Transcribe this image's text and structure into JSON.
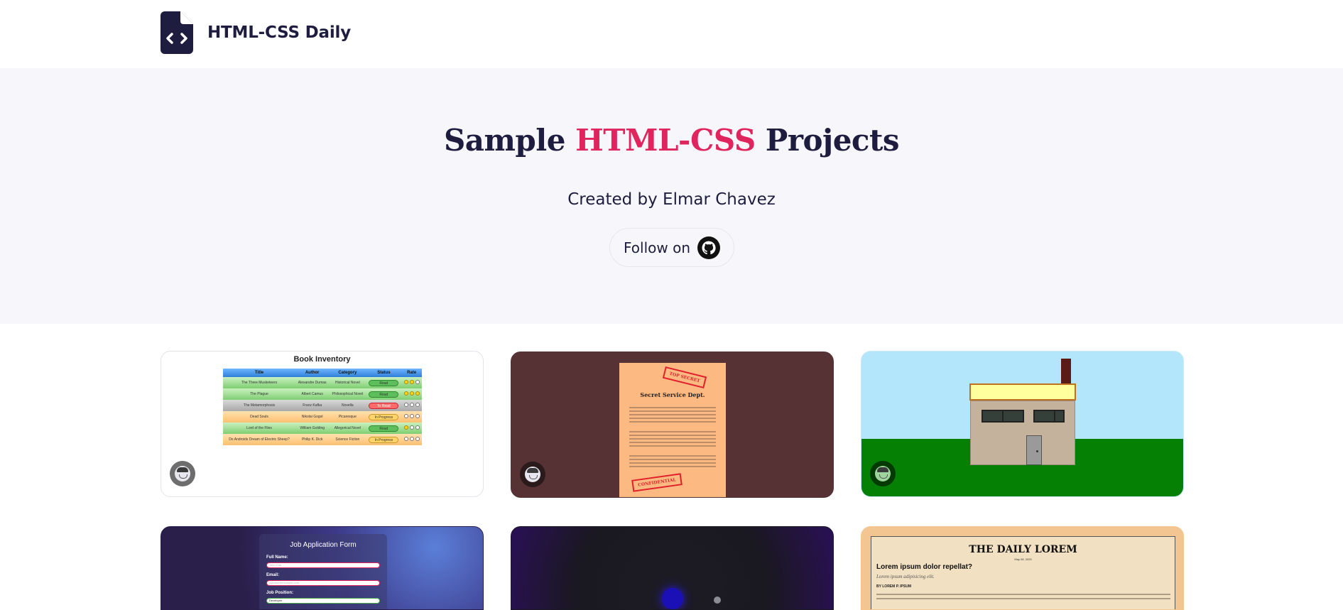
{
  "header": {
    "brand_name": "HTML-CSS Daily"
  },
  "hero": {
    "title_part1": "Sample ",
    "title_accent": "HTML-CSS",
    "title_part2": " Projects",
    "subtitle": "Created by Elmar Chavez",
    "follow_label": "Follow on"
  },
  "colors": {
    "accent": "#e0245e",
    "navy": "#1f1d3f",
    "hero_bg": "#f7f7fb"
  },
  "cards": [
    {
      "name": "book-inventory",
      "title": "Book Inventory",
      "columns": [
        "Title",
        "Author",
        "Category",
        "Status",
        "Rate"
      ],
      "rows": [
        {
          "title": "The Three Musketeers",
          "author": "Alexandre Dumas",
          "category": "Historical Novel",
          "status": "Read",
          "rate": 2
        },
        {
          "title": "The Plague",
          "author": "Albert Camus",
          "category": "Philosophical Novel",
          "status": "Read",
          "rate": 3
        },
        {
          "title": "The Metamorphosis",
          "author": "Franz Kafka",
          "category": "Novella",
          "status": "To Read",
          "rate": 0
        },
        {
          "title": "Dead Souls",
          "author": "Nikolai Gogol",
          "category": "Picaresque",
          "status": "In Progress",
          "rate": 0
        },
        {
          "title": "Lord of the Flies",
          "author": "William Golding",
          "category": "Allegorical Novel",
          "status": "Read",
          "rate": 1
        },
        {
          "title": "Do Androids Dream of Electric Sheep?",
          "author": "Philip K. Dick",
          "category": "Science Fiction",
          "status": "In Progress",
          "rate": 0
        }
      ]
    },
    {
      "name": "secret-service",
      "title": "Secret Service Dept.",
      "stamp_top": "TOP SECRET",
      "stamp_bottom": "CONFIDENTIAL"
    },
    {
      "name": "house-scene"
    },
    {
      "name": "job-application",
      "title": "Job Application Form",
      "fields": [
        {
          "label": "Full Name:",
          "placeholder": "John Doe"
        },
        {
          "label": "Email:",
          "placeholder": "johndoe@example.com"
        },
        {
          "label": "Job Position:",
          "value": "Developer"
        }
      ]
    },
    {
      "name": "dark-orb"
    },
    {
      "name": "daily-lorem",
      "masthead": "THE DAILY LOREM",
      "date": "May 08, 2025",
      "headline": "Lorem ipsum dolor repellat?",
      "subhead": "Lorem ipsum adipisicing elit.",
      "byline": "BY LOREM P. IPSUM"
    }
  ]
}
